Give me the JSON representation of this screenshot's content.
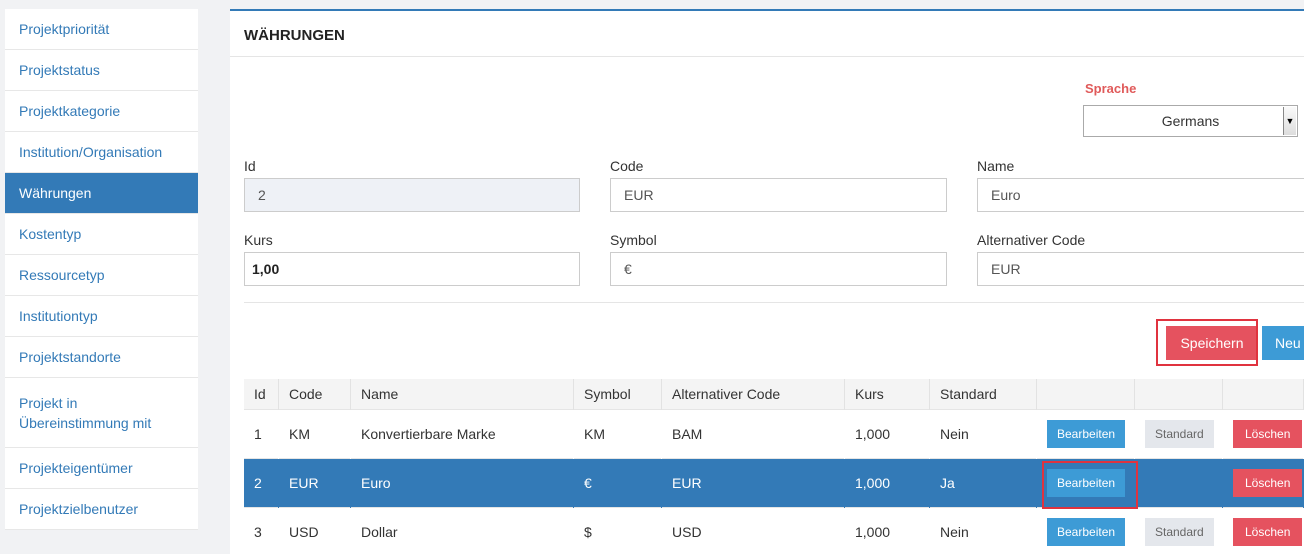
{
  "sidebar": {
    "items": [
      {
        "label": "Projektpriorität"
      },
      {
        "label": "Projektstatus"
      },
      {
        "label": "Projektkategorie"
      },
      {
        "label": "Institution/Organisation"
      },
      {
        "label": "Währungen"
      },
      {
        "label": "Kostentyp"
      },
      {
        "label": "Ressourcetyp"
      },
      {
        "label": "Institutiontyp"
      },
      {
        "label": "Projektstandorte"
      },
      {
        "label": "Projekt in Übereinstimmung mit"
      },
      {
        "label": "Projekteigentümer"
      },
      {
        "label": "Projektzielbenutzer"
      }
    ]
  },
  "main": {
    "title": "WÄHRUNGEN",
    "language": {
      "label": "Sprache",
      "value": "Germans"
    },
    "form": {
      "id_label": "Id",
      "id_value": "2",
      "code_label": "Code",
      "code_value": "EUR",
      "name_label": "Name",
      "name_value": "Euro",
      "kurs_label": "Kurs",
      "kurs_value": "1,00",
      "symbol_label": "Symbol",
      "symbol_value": "€",
      "altcode_label": "Alternativer Code",
      "altcode_value": "EUR"
    },
    "buttons": {
      "save": "Speichern",
      "new": "Neu"
    },
    "table": {
      "headers": [
        "Id",
        "Code",
        "Name",
        "Symbol",
        "Alternativer Code",
        "Kurs",
        "Standard"
      ],
      "rows": [
        {
          "id": "1",
          "code": "KM",
          "name": "Konvertierbare Marke",
          "symbol": "KM",
          "alt": "BAM",
          "kurs": "1,000",
          "standard": "Nein"
        },
        {
          "id": "2",
          "code": "EUR",
          "name": "Euro",
          "symbol": "€",
          "alt": "EUR",
          "kurs": "1,000",
          "standard": "Ja"
        },
        {
          "id": "3",
          "code": "USD",
          "name": "Dollar",
          "symbol": "$",
          "alt": "USD",
          "kurs": "1,000",
          "standard": "Nein"
        }
      ],
      "edit_label": "Bearbeiten",
      "standard_label": "Standard",
      "delete_label": "Löschen"
    }
  }
}
